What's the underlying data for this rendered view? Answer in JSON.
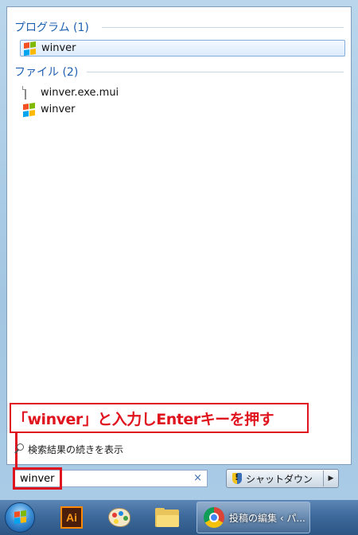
{
  "sections": [
    {
      "title": "プログラム (1)",
      "items": [
        {
          "label": "winver",
          "icon": "windows-logo-icon",
          "selected": true
        }
      ]
    },
    {
      "title": "ファイル (2)",
      "items": [
        {
          "label": "winver.exe.mui",
          "icon": "document-icon",
          "selected": false
        },
        {
          "label": "winver",
          "icon": "windows-logo-icon",
          "selected": false
        }
      ]
    }
  ],
  "annotation": "「winver」と入力しEnterキーを押す",
  "see_more": "検索結果の続きを表示",
  "search": {
    "value": "winver",
    "clear": "×"
  },
  "shutdown": {
    "label": "シャットダウン",
    "arrow": "▶"
  },
  "taskbar": {
    "apps": [
      {
        "name": "illustrator",
        "label": "Ai"
      },
      {
        "name": "paint"
      },
      {
        "name": "explorer"
      }
    ],
    "active_window": {
      "label": "投稿の編集 ‹ パ..."
    }
  },
  "colors": {
    "accent": "#1e5fb0",
    "annotation": "#e0141e",
    "taskbar": "#3d6a9c"
  }
}
